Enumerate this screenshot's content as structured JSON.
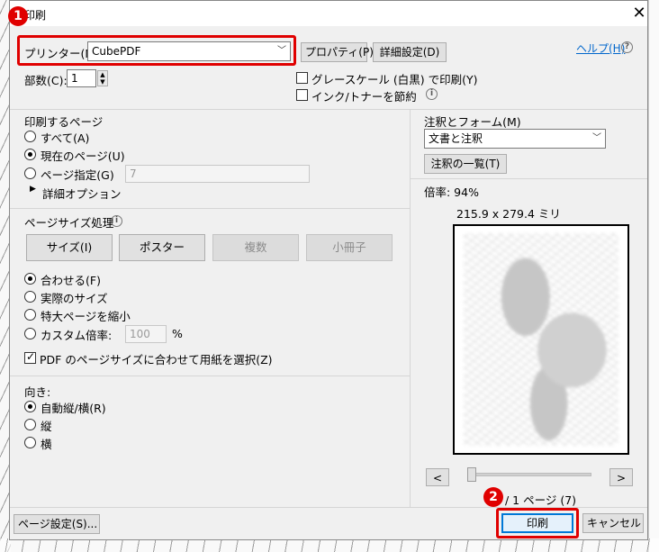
{
  "window": {
    "title": "印刷"
  },
  "printer": {
    "label": "プリンター(N):",
    "value": "CubePDF",
    "properties_button": "プロパティ(P)",
    "advanced_button": "詳細設定(D)",
    "help_link": "ヘルプ(H)",
    "copies_label": "部数(C):",
    "copies_value": "1",
    "grayscale_label": "グレースケール (白黒) で印刷(Y)",
    "grayscale_checked": false,
    "ink_save_label": "インク/トナーを節約",
    "ink_save_checked": false
  },
  "pages": {
    "heading": "印刷するページ",
    "all_label": "すべて(A)",
    "current_label": "現在のページ(U)",
    "range_label": "ページ指定(G)",
    "range_value": "7",
    "more_options_label": "詳細オプション",
    "selected": "current"
  },
  "page_sizing": {
    "heading": "ページサイズ処理",
    "buttons": {
      "size": "サイズ(I)",
      "poster": "ポスター",
      "multiple": "複数",
      "booklet": "小冊子"
    },
    "fit_label": "合わせる(F)",
    "actual_label": "実際のサイズ",
    "shrink_label": "特大ページを縮小",
    "custom_label": "カスタム倍率:",
    "custom_value": "100",
    "custom_unit": "%",
    "selected": "fit",
    "choose_paper_label": "PDF のページサイズに合わせて用紙を選択(Z)",
    "choose_paper_checked": true
  },
  "orientation": {
    "heading": "向き:",
    "auto_label": "自動縦/横(R)",
    "portrait_label": "縦",
    "landscape_label": "横",
    "selected": "auto"
  },
  "comments": {
    "heading": "注釈とフォーム(M)",
    "value": "文書と注釈",
    "summary_button": "注釈の一覧(T)"
  },
  "preview": {
    "scale_label": "倍率: 94%",
    "paper_size": "215.9 x 279.4 ミリ",
    "prev_button": "<",
    "next_button": ">",
    "page_indicator": "/ 1 ページ (7)"
  },
  "footer": {
    "page_setup_button": "ページ設定(S)...",
    "print_button": "印刷",
    "cancel_button": "キャンセル"
  },
  "annotations": {
    "badge1": "1",
    "badge2": "2",
    "highlight_color": "#e00000"
  }
}
